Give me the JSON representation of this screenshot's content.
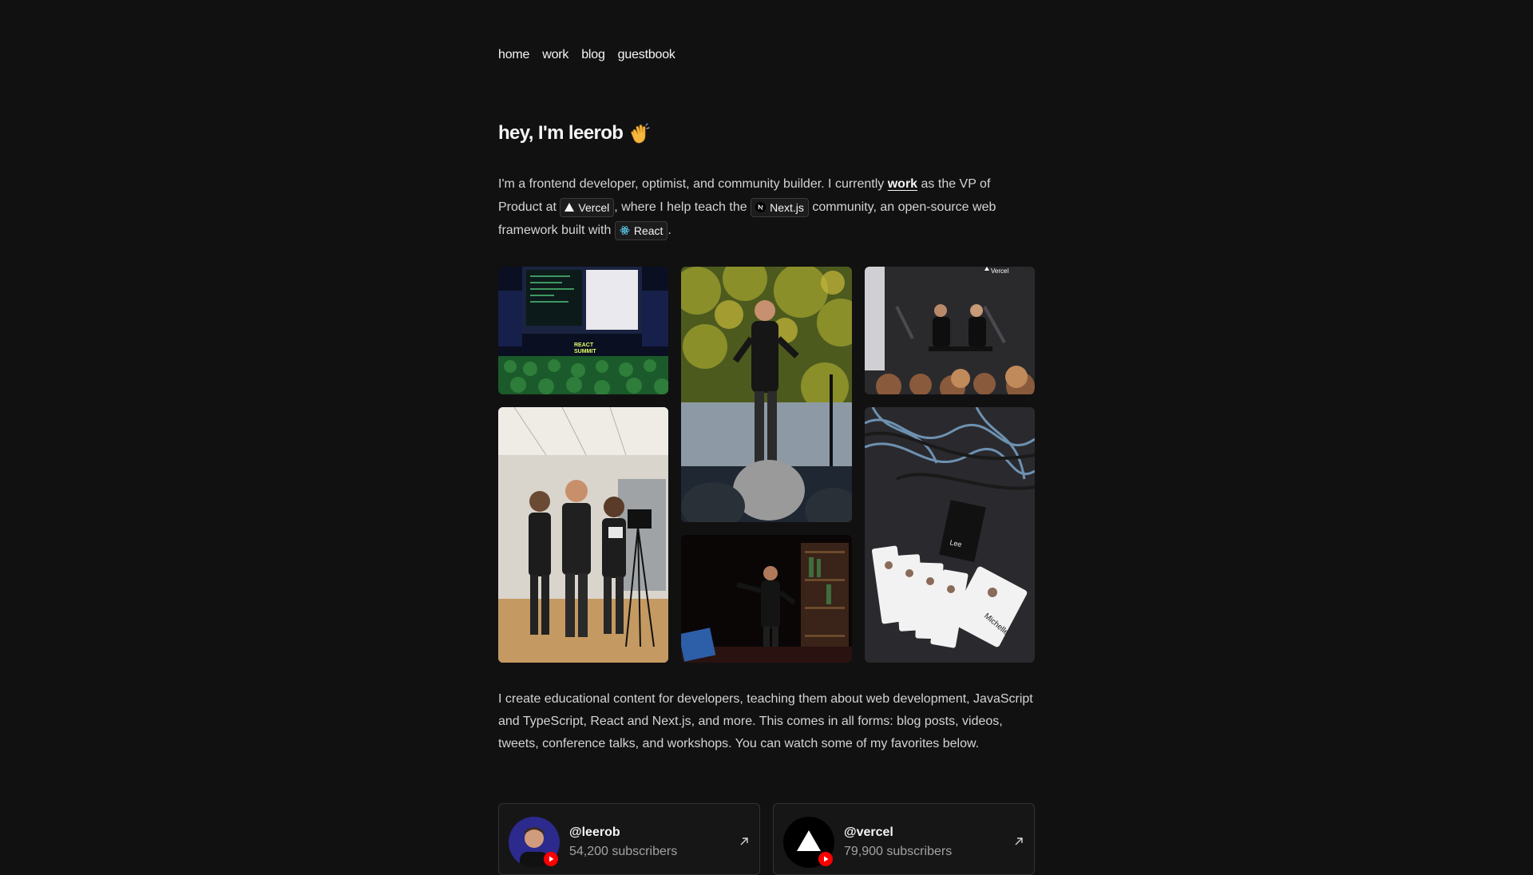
{
  "nav": {
    "items": [
      "home",
      "work",
      "blog",
      "guestbook"
    ]
  },
  "hero": {
    "title": "hey, I'm leerob",
    "emoji_icon": "waving-hand-icon"
  },
  "intro": {
    "part1": "I'm a frontend developer, optimist, and community builder. I currently ",
    "work_link": "work",
    "part2": " as the VP of Product at ",
    "vercel_badge": "Vercel",
    "part3": ", where I help teach the ",
    "nextjs_badge": "Next.js",
    "part4": " community, an open-source web framework built with ",
    "react_badge": "React",
    "part5": "."
  },
  "paragraph2": "I create educational content for developers, teaching them about web development, JavaScript and TypeScript, React and Next.js, and more. This comes in all forms: blog posts, videos, tweets, conference talks, and workshops. You can watch some of my favorites below.",
  "channels": [
    {
      "handle": "@leerob",
      "subscribers": "54,200 subscribers",
      "avatar_icon": "leerob-avatar",
      "badge_icon": "youtube-icon"
    },
    {
      "handle": "@vercel",
      "subscribers": "79,900 subscribers",
      "avatar_icon": "vercel-logo-avatar",
      "badge_icon": "youtube-icon"
    }
  ],
  "colors": {
    "background": "#111111",
    "text": "#d4d4d4",
    "heading": "#f5f5f5",
    "muted": "#a3a3a3",
    "border": "#333333",
    "youtube_red": "#ff0000"
  }
}
